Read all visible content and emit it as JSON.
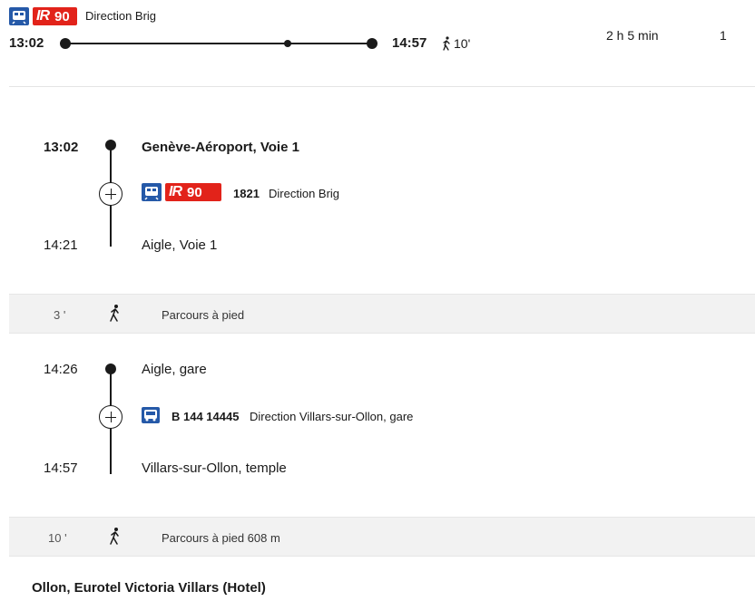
{
  "summary": {
    "line_prefix": "IR",
    "line_number": "90",
    "direction": "Direction Brig",
    "depart_time": "13:02",
    "arrive_time": "14:57",
    "walk": "10'",
    "duration": "2 h 5 min",
    "changes": "1"
  },
  "legs": [
    {
      "depart_time": "13:02",
      "depart_stop": "Genève-Aéroport, Voie 1",
      "line_prefix": "IR",
      "line_number": "90",
      "trip_number": "1821",
      "direction": "Direction Brig",
      "arrive_time": "14:21",
      "arrive_stop": "Aigle, Voie 1"
    },
    {
      "depart_time": "14:26",
      "depart_stop": "Aigle, gare",
      "bus_line": "B 144 14445",
      "direction": "Direction Villars-sur-Ollon, gare",
      "arrive_time": "14:57",
      "arrive_stop": "Villars-sur-Ollon, temple"
    }
  ],
  "walks": [
    {
      "minutes": "3 '",
      "label": "Parcours à pied"
    },
    {
      "minutes": "10 '",
      "label": "Parcours à pied 608 m"
    }
  ],
  "destination": "Ollon, Eurotel Victoria Villars (Hotel)",
  "icons": {
    "train": "train-icon",
    "bus": "bus-icon",
    "walk": "walking-person-icon",
    "expand": "plus-circle-icon"
  },
  "colors": {
    "sbb_blue": "#2559a8",
    "ir_red": "#e2231a"
  }
}
